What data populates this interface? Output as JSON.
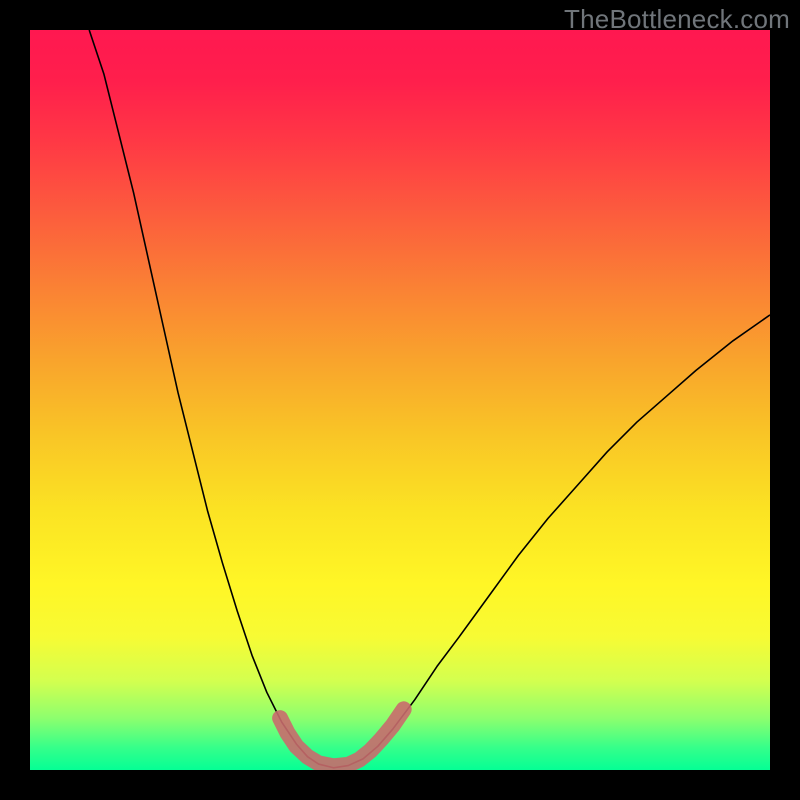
{
  "watermark": "TheBottleneck.com",
  "chart_data": {
    "type": "line",
    "title": "",
    "xlabel": "",
    "ylabel": "",
    "xlim": [
      0,
      100
    ],
    "ylim": [
      0,
      100
    ],
    "grid": false,
    "legend": false,
    "background_gradient": {
      "stops": [
        {
          "offset": 0.0,
          "color": "#ff1850"
        },
        {
          "offset": 0.07,
          "color": "#ff1f4c"
        },
        {
          "offset": 0.15,
          "color": "#ff3845"
        },
        {
          "offset": 0.25,
          "color": "#fc5d3d"
        },
        {
          "offset": 0.35,
          "color": "#fa8234"
        },
        {
          "offset": 0.45,
          "color": "#f9a52c"
        },
        {
          "offset": 0.55,
          "color": "#f9c626"
        },
        {
          "offset": 0.65,
          "color": "#fbe323"
        },
        {
          "offset": 0.75,
          "color": "#fff626"
        },
        {
          "offset": 0.82,
          "color": "#f7fb34"
        },
        {
          "offset": 0.88,
          "color": "#d3ff4f"
        },
        {
          "offset": 0.93,
          "color": "#8dff6e"
        },
        {
          "offset": 0.97,
          "color": "#35ff8a"
        },
        {
          "offset": 1.0,
          "color": "#05ff95"
        }
      ]
    },
    "series": [
      {
        "name": "bottleneck-curve",
        "stroke": "#000000",
        "stroke_width": 1.6,
        "points": [
          {
            "x": 8.0,
            "y": 100.0
          },
          {
            "x": 10.0,
            "y": 94.0
          },
          {
            "x": 12.0,
            "y": 86.0
          },
          {
            "x": 14.0,
            "y": 78.0
          },
          {
            "x": 16.0,
            "y": 69.0
          },
          {
            "x": 18.0,
            "y": 60.0
          },
          {
            "x": 20.0,
            "y": 51.0
          },
          {
            "x": 22.0,
            "y": 43.0
          },
          {
            "x": 24.0,
            "y": 35.0
          },
          {
            "x": 26.0,
            "y": 28.0
          },
          {
            "x": 28.0,
            "y": 21.5
          },
          {
            "x": 30.0,
            "y": 15.5
          },
          {
            "x": 32.0,
            "y": 10.5
          },
          {
            "x": 34.0,
            "y": 6.5
          },
          {
            "x": 36.0,
            "y": 3.5
          },
          {
            "x": 37.5,
            "y": 1.8
          },
          {
            "x": 39.0,
            "y": 0.8
          },
          {
            "x": 41.0,
            "y": 0.3
          },
          {
            "x": 43.0,
            "y": 0.6
          },
          {
            "x": 45.0,
            "y": 1.5
          },
          {
            "x": 47.0,
            "y": 3.2
          },
          {
            "x": 49.0,
            "y": 5.5
          },
          {
            "x": 52.0,
            "y": 9.5
          },
          {
            "x": 55.0,
            "y": 14.0
          },
          {
            "x": 58.0,
            "y": 18.0
          },
          {
            "x": 62.0,
            "y": 23.5
          },
          {
            "x": 66.0,
            "y": 29.0
          },
          {
            "x": 70.0,
            "y": 34.0
          },
          {
            "x": 74.0,
            "y": 38.5
          },
          {
            "x": 78.0,
            "y": 43.0
          },
          {
            "x": 82.0,
            "y": 47.0
          },
          {
            "x": 86.0,
            "y": 50.5
          },
          {
            "x": 90.0,
            "y": 54.0
          },
          {
            "x": 95.0,
            "y": 58.0
          },
          {
            "x": 100.0,
            "y": 61.5
          }
        ]
      },
      {
        "name": "highlight-band",
        "stroke": "#c96b6d",
        "stroke_width": 16,
        "opacity": 0.9,
        "linecap": "round",
        "points": [
          {
            "x": 33.8,
            "y": 7.0
          },
          {
            "x": 34.8,
            "y": 5.0
          },
          {
            "x": 36.0,
            "y": 3.2
          },
          {
            "x": 37.5,
            "y": 1.8
          },
          {
            "x": 39.0,
            "y": 0.9
          },
          {
            "x": 41.0,
            "y": 0.5
          },
          {
            "x": 43.0,
            "y": 0.7
          },
          {
            "x": 44.5,
            "y": 1.4
          },
          {
            "x": 46.0,
            "y": 2.6
          },
          {
            "x": 47.5,
            "y": 4.2
          },
          {
            "x": 49.0,
            "y": 6.0
          },
          {
            "x": 50.5,
            "y": 8.2
          }
        ]
      }
    ]
  }
}
